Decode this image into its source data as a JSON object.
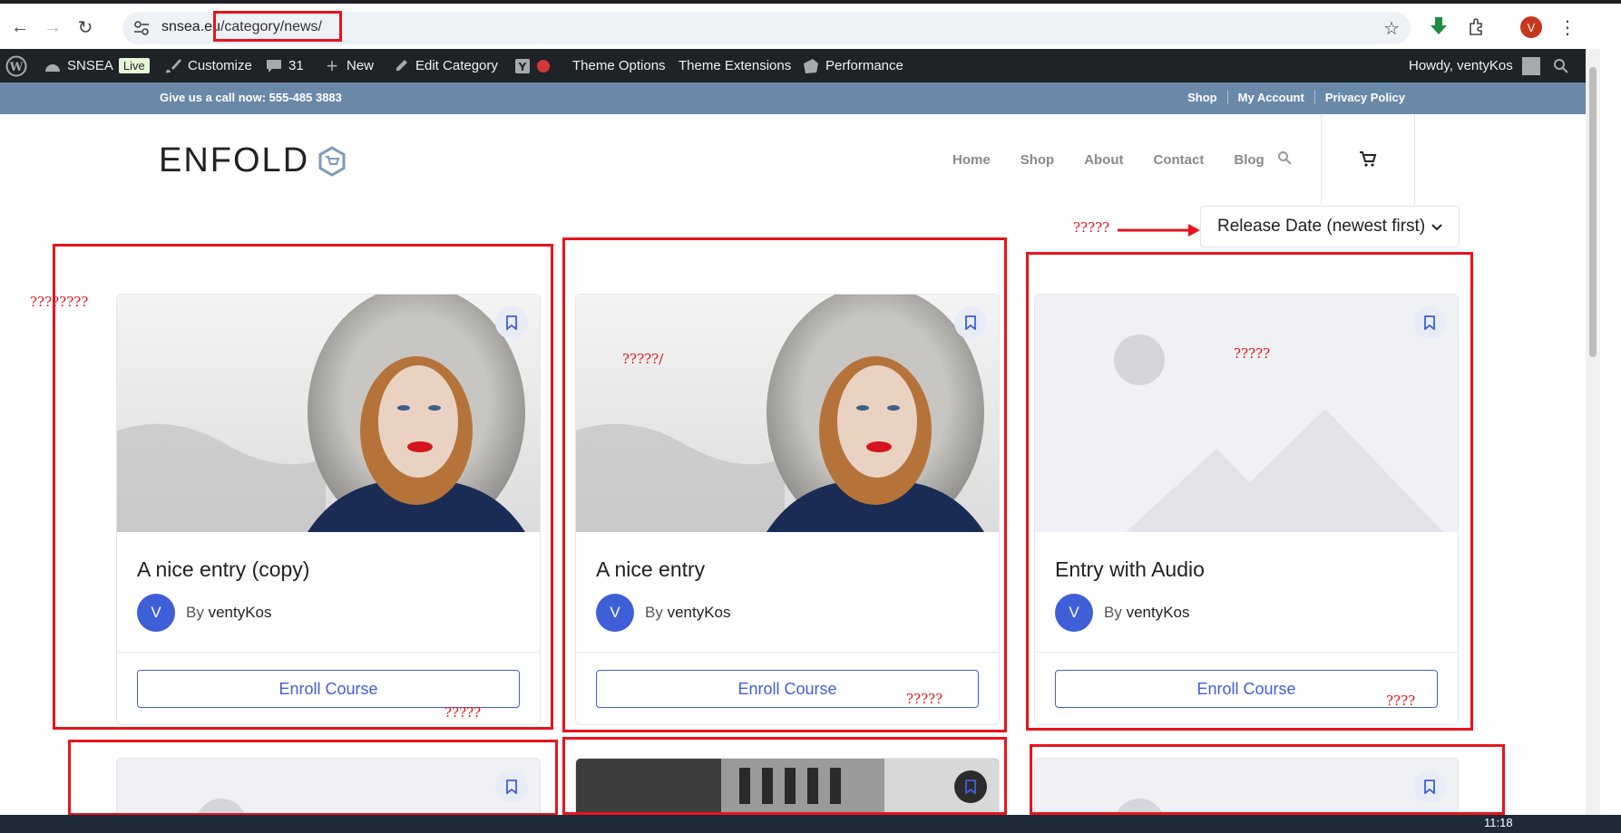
{
  "browser": {
    "url_domain": "snsea.eu",
    "url_path": "/category/news/",
    "profile_initial": "V"
  },
  "admin_bar": {
    "site_name": "SNSEA",
    "live_badge": "Live",
    "customize": "Customize",
    "comments_count": "31",
    "new": "New",
    "edit_category": "Edit Category",
    "theme_options": "Theme Options",
    "theme_extensions": "Theme Extensions",
    "performance": "Performance",
    "howdy": "Howdy, ventyKos"
  },
  "topbar": {
    "call_text": "Give us a call now: 555-485 3883",
    "links": [
      "Shop",
      "My Account",
      "Privacy Policy"
    ]
  },
  "header": {
    "logo_text": "ENFOLD",
    "nav": [
      "Home",
      "Shop",
      "About",
      "Contact",
      "Blog"
    ]
  },
  "sort": {
    "selected": "Release Date (newest first)"
  },
  "cards": [
    {
      "title": "A nice entry (copy)",
      "author_initial": "V",
      "by_label": "By",
      "author": "ventyKos",
      "button": "Enroll Course",
      "image": "winter-portrait"
    },
    {
      "title": "A nice entry",
      "author_initial": "V",
      "by_label": "By",
      "author": "ventyKos",
      "button": "Enroll Course",
      "image": "winter-portrait"
    },
    {
      "title": "Entry with Audio",
      "author_initial": "V",
      "by_label": "By",
      "author": "ventyKos",
      "button": "Enroll Course",
      "image": "placeholder"
    }
  ],
  "annotations": {
    "sort_label": "?????",
    "left_label": "????????",
    "card1_label": "?????",
    "card2_top_label": "?????/",
    "card2_label": "?????",
    "card3_top_label": "?????",
    "card3_label": "????"
  },
  "taskbar": {
    "clock": "11:18"
  },
  "colors": {
    "accent": "#3f5fd8",
    "topbar": "#6a89a8",
    "admin_bar": "#1d2327",
    "annotation": "#e8141c"
  }
}
